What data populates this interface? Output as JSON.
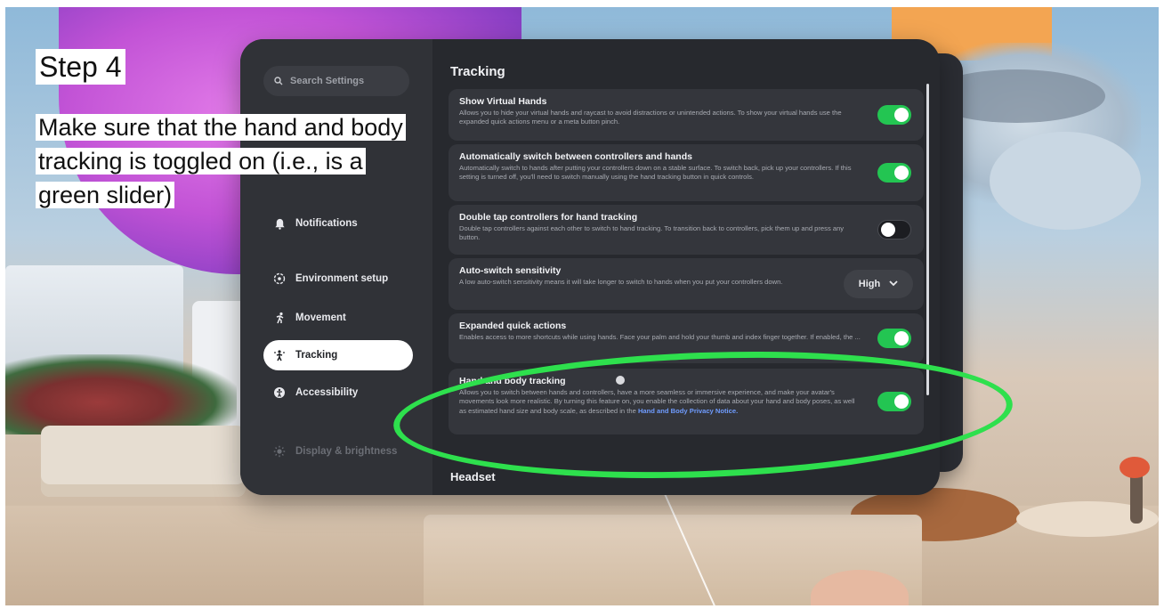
{
  "annotation": {
    "step": "Step 4",
    "instructions": "Make sure that the hand and body tracking is toggled on (i.e., is a green slider)"
  },
  "colors": {
    "toggle_on": "#23c552",
    "highlight_ring": "#2ee04d",
    "link": "#6f9cff",
    "panel_bg": "#27292e"
  },
  "sidebar": {
    "search_placeholder": "Search Settings",
    "items": [
      {
        "label": "Notifications",
        "icon": "bell-icon",
        "active": false
      },
      {
        "label": "Environment setup",
        "icon": "environment-icon",
        "active": false
      },
      {
        "label": "Movement",
        "icon": "movement-icon",
        "active": false
      },
      {
        "label": "Tracking",
        "icon": "tracking-icon",
        "active": true
      },
      {
        "label": "Accessibility",
        "icon": "accessibility-icon",
        "active": false
      },
      {
        "label": "Display & brightness",
        "icon": "brightness-icon",
        "active": false
      }
    ]
  },
  "main": {
    "section_title": "Tracking",
    "next_section_title": "Headset",
    "settings": [
      {
        "title": "Show Virtual Hands",
        "description": "Allows you to hide your virtual hands and raycast to avoid distractions or unintended actions. To show your virtual hands use the expanded quick actions menu or a meta button pinch.",
        "control": "toggle",
        "state": "on"
      },
      {
        "title": "Automatically switch between controllers and hands",
        "description": "Automatically switch to hands after putting your controllers down on a stable surface. To switch back, pick up your controllers. If this setting is turned off, you'll need to switch manually using the hand tracking button in quick controls.",
        "control": "toggle",
        "state": "on"
      },
      {
        "title": "Double tap controllers for hand tracking",
        "description": "Double tap controllers against each other to switch to hand tracking. To transition back to controllers, pick them up and press any button.",
        "control": "toggle",
        "state": "off"
      },
      {
        "title": "Auto-switch sensitivity",
        "description": "A low auto-switch sensitivity means it will take longer to switch to hands when you put your controllers down.",
        "control": "dropdown",
        "value": "High"
      },
      {
        "title": "Expanded quick actions",
        "description": "Enables access to more shortcuts while using hands. Face your palm and hold your thumb and index finger together. If enabled, the ...",
        "control": "toggle",
        "state": "on"
      },
      {
        "title": "Hand and body tracking",
        "description": "Allows you to switch between hands and controllers, have a more seamless or immersive experience, and make your avatar's movements look more realistic. By turning this feature on, you enable the collection of data about your hand and body poses, as well as estimated hand size and body scale, as described in the",
        "link": "Hand and Body Privacy Notice.",
        "control": "toggle",
        "state": "on"
      }
    ]
  }
}
